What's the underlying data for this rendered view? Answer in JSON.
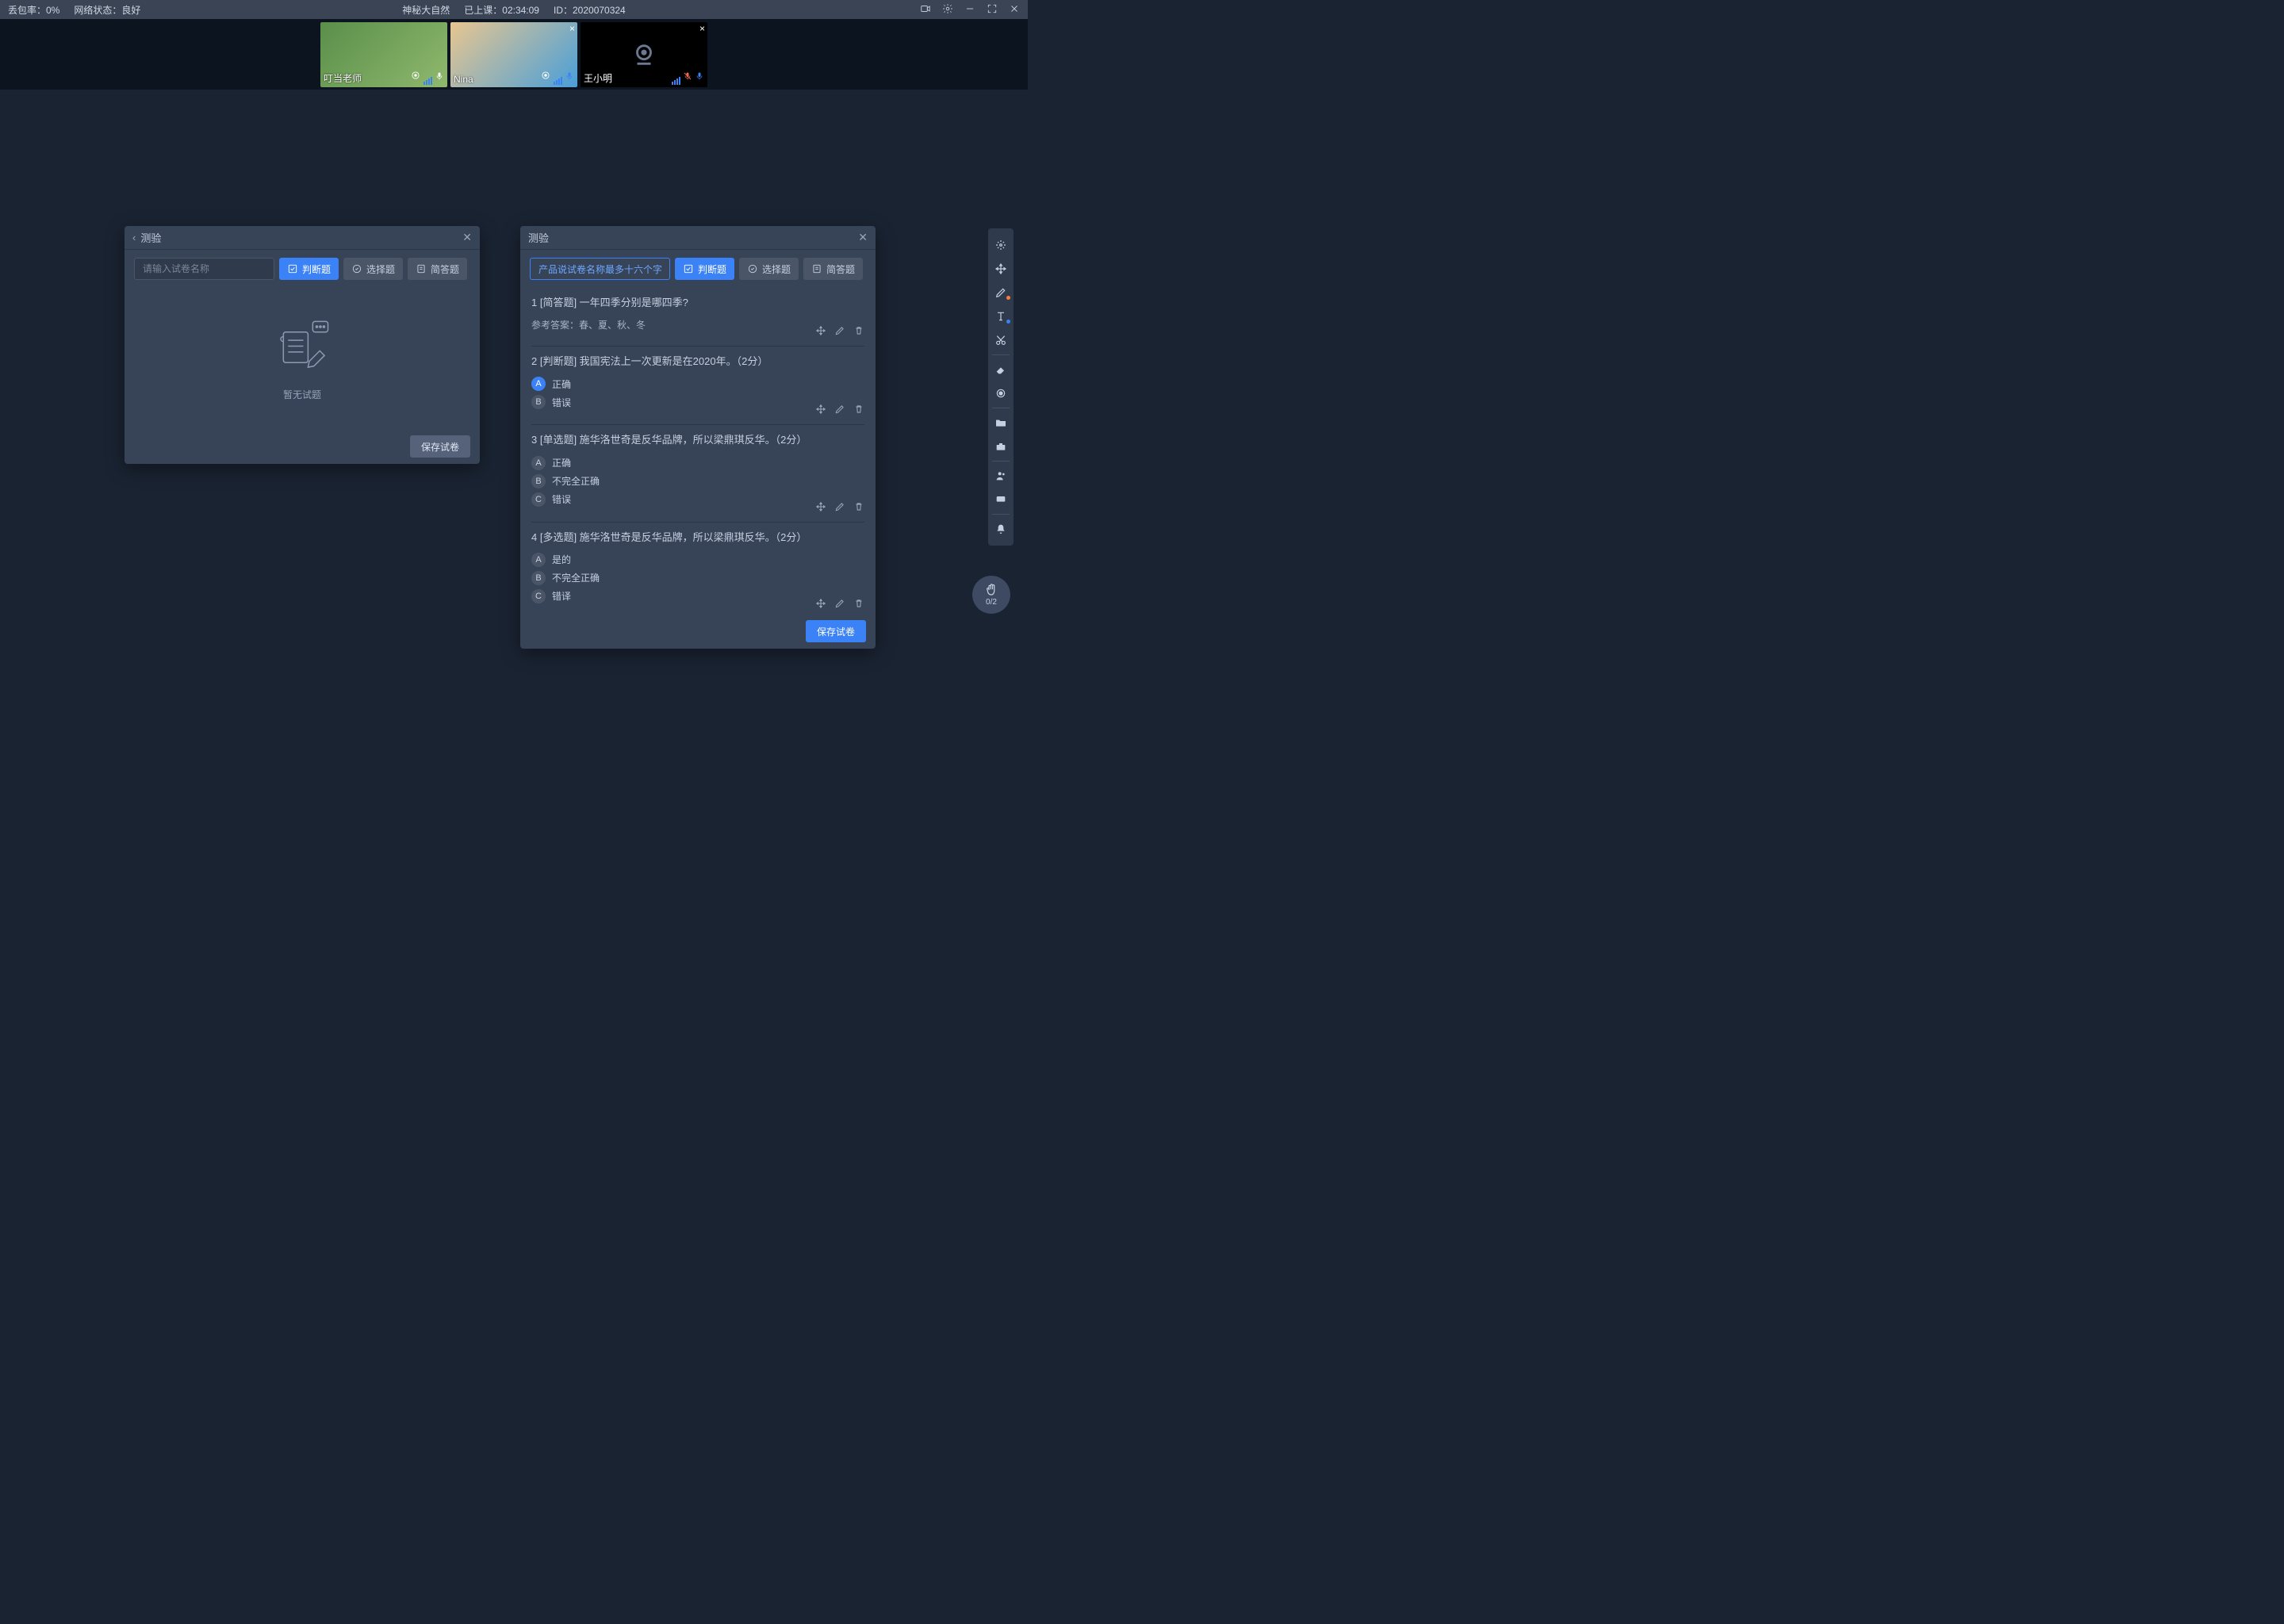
{
  "topbar": {
    "packet_loss_label": "丢包率：0%",
    "network_label": "网络状态：良好",
    "title": "神秘大自然",
    "duration_label": "已上课：02:34:09",
    "id_label": "ID：2020070324"
  },
  "videos": [
    {
      "name": "叮当老师",
      "has_close": false,
      "mic_color": "#ffffff",
      "cam": true
    },
    {
      "name": "Nina",
      "has_close": true,
      "mic_color": "#3b82f6",
      "cam": true
    },
    {
      "name": "王小明",
      "has_close": true,
      "mic_color": "#3b82f6",
      "cam_off": true,
      "mic_off": true
    }
  ],
  "panel_left": {
    "title": "测验",
    "placeholder": "请输入试卷名称",
    "tabs": {
      "judge": "判断题",
      "choice": "选择题",
      "short": "简答题"
    },
    "empty": "暂无试题",
    "save": "保存试卷"
  },
  "panel_right": {
    "title": "测验",
    "title_value": "产品说试卷名称最多十六个字",
    "tabs": {
      "judge": "判断题",
      "choice": "选择题",
      "short": "简答题"
    },
    "save": "保存试卷",
    "questions": [
      {
        "num": "1",
        "tag": "[简答题]",
        "text": "一年四季分别是哪四季?",
        "answer_label": "参考答案：春、夏、秋、冬",
        "options": []
      },
      {
        "num": "2",
        "tag": "[判断题]",
        "text": "我国宪法上一次更新是在2020年。（2分）",
        "options": [
          {
            "key": "A",
            "label": "正确",
            "active": true
          },
          {
            "key": "B",
            "label": "错误",
            "active": false
          }
        ]
      },
      {
        "num": "3",
        "tag": "[单选题]",
        "text": "施华洛世奇是反华品牌，所以梁鼎琪反华。（2分）",
        "options": [
          {
            "key": "A",
            "label": "正确",
            "active": false
          },
          {
            "key": "B",
            "label": "不完全正确",
            "active": false
          },
          {
            "key": "C",
            "label": "错误",
            "active": false
          }
        ]
      },
      {
        "num": "4",
        "tag": "[多选题]",
        "text": "施华洛世奇是反华品牌，所以梁鼎琪反华。（2分）",
        "options": [
          {
            "key": "A",
            "label": "是的",
            "active": false
          },
          {
            "key": "B",
            "label": "不完全正确",
            "active": false
          },
          {
            "key": "C",
            "label": "错译",
            "active": false
          }
        ]
      }
    ]
  },
  "hand": {
    "count": "0/2"
  }
}
